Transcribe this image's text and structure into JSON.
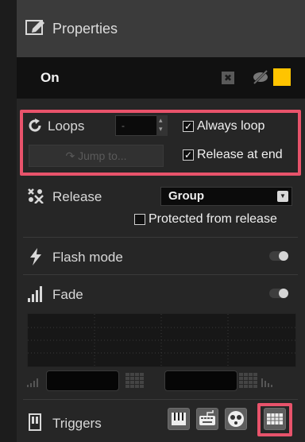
{
  "title": "Properties",
  "on_row": {
    "label": "On",
    "swatch_color": "#ffc400",
    "clear_glyph": "✖"
  },
  "loops": {
    "label": "Loops",
    "value": "-",
    "jump_label": "↷ Jump to...",
    "always_loop": {
      "label": "Always loop",
      "checked": true
    },
    "release_at_end": {
      "label": "Release at end",
      "checked": true
    }
  },
  "release": {
    "label": "Release",
    "select_value": "Group",
    "protected": {
      "label": "Protected from release",
      "checked": false
    }
  },
  "flash": {
    "label": "Flash mode",
    "enabled": false
  },
  "fade": {
    "label": "Fade",
    "enabled": false
  },
  "triggers": {
    "label": "Triggers",
    "buttons": [
      "piano-keys-icon",
      "keyboard-icon",
      "joystick-icon",
      "keypad-grid-icon"
    ]
  },
  "colors": {
    "highlight": "#e8536b",
    "accent": "#ffc400"
  }
}
